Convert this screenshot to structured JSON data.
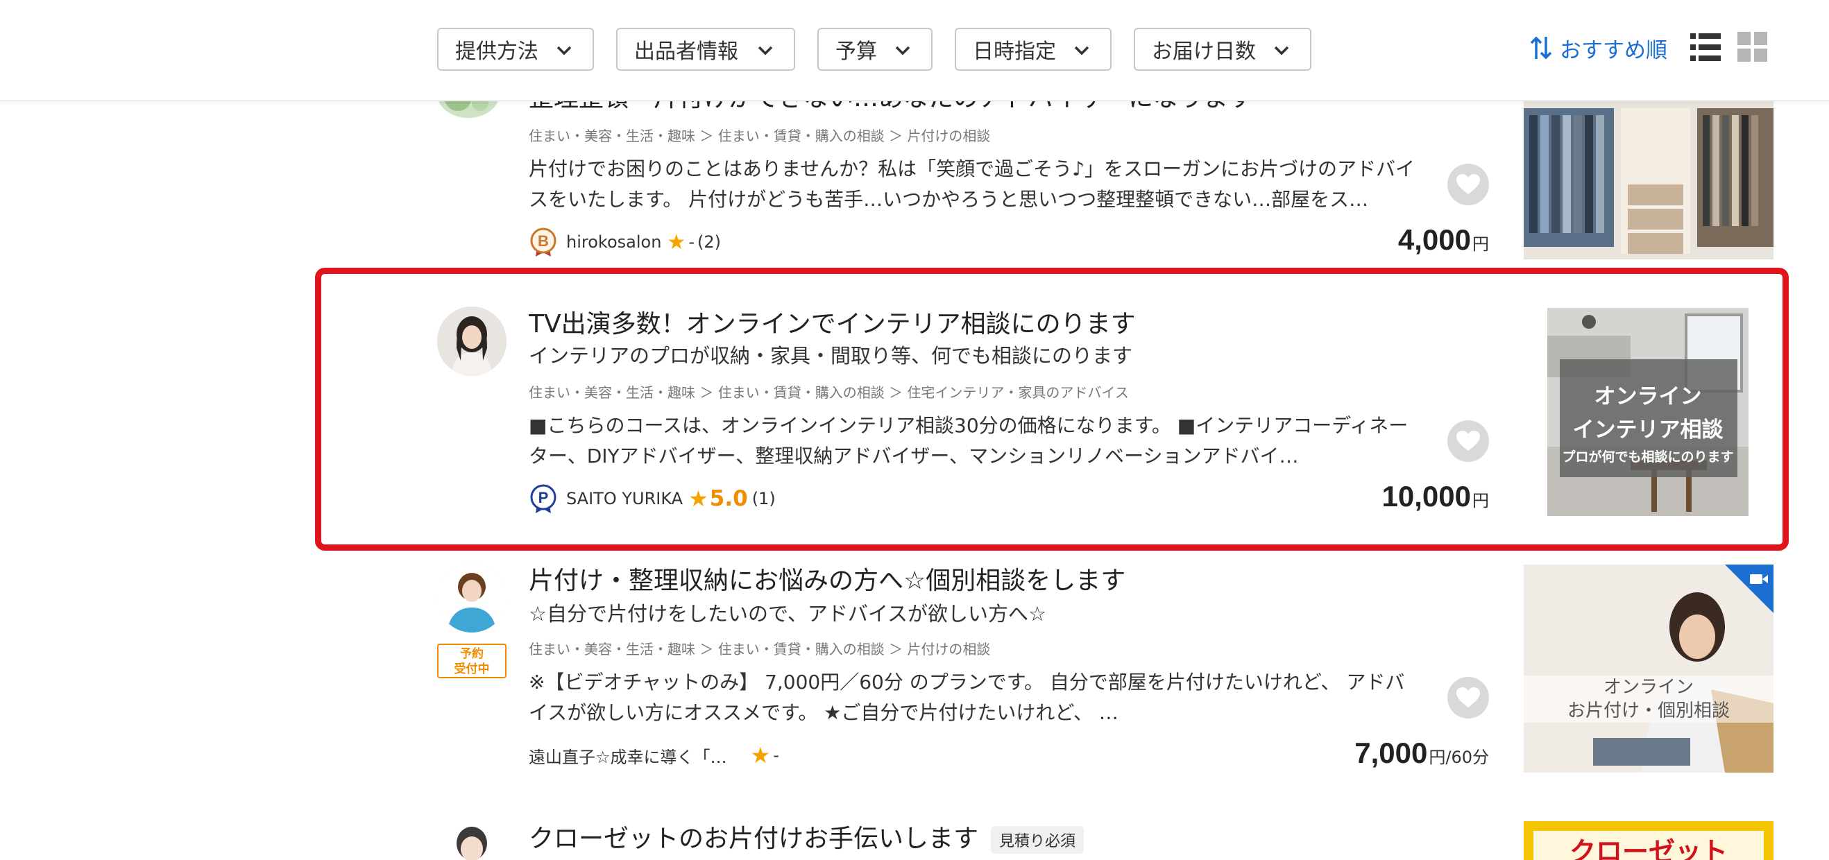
{
  "filters": [
    {
      "label": "提供方法"
    },
    {
      "label": "出品者情報"
    },
    {
      "label": "予算"
    },
    {
      "label": "日時指定"
    },
    {
      "label": "お届け日数"
    }
  ],
  "sort": {
    "label": "おすすめ順"
  },
  "view": {
    "list_icon": "list-view-icon",
    "grid_icon": "grid-view-icon"
  },
  "colors": {
    "accent": "#1a6fd1",
    "highlight": "#e0151b",
    "star": "#f5a300",
    "reserve": "#f08c00"
  },
  "items": [
    {
      "title": "整理整頓・片付けができない…あなたのアドバイザーになります",
      "crumbs": "住まい・美容・生活・趣味 ＞ 住まい・賃貸・購入の相談 ＞ 片付けの相談",
      "desc": "片付けでお困りのことはありませんか？私は「笑顔で過ごそう♪」をスローガンにお片づけのアドバイスをいたします。 片付けがどうも苦手…いつかやろうと思いつつ整理整頓できない…部屋をス…",
      "seller": "hirokosalon",
      "rank": "B",
      "rating": "-",
      "reviews": "(2)",
      "price": "4,000",
      "unit": "円"
    },
    {
      "title": "TV出演多数！オンラインでインテリア相談にのります",
      "subtitle": "インテリアのプロが収納・家具・間取り等、何でも相談にのります",
      "crumbs": "住まい・美容・生活・趣味 ＞ 住まい・賃貸・購入の相談 ＞ 住宅インテリア・家具のアドバイス",
      "desc": "■こちらのコースは、オンラインインテリア相談30分の価格になります。 ■インテリアコーディネーター、DIYアドバイザー、整理収納アドバイザー、マンションリノベーションアドバイ…",
      "seller": "SAITO YURIKA",
      "rank": "P",
      "rating": "5.0",
      "reviews": "(1)",
      "price": "10,000",
      "unit": "円",
      "thumb_line1": "オンライン",
      "thumb_line2": "インテリア相談",
      "thumb_line3": "プロが何でも相談にのります"
    },
    {
      "title": "片付け・整理収納にお悩みの方へ☆個別相談をします",
      "subtitle": "☆自分で片付けをしたいので、アドバイスが欲しい方へ☆",
      "crumbs": "住まい・美容・生活・趣味 ＞ 住まい・賃貸・購入の相談 ＞ 片付けの相談",
      "desc": "※【ビデオチャットのみ】 7,000円／60分 のプランです。 自分で部屋を片付けたいけれど、 アドバイスが欲しい方にオススメです。 ★ご自分で片付けたいけれど、 …",
      "seller": "遠山直子☆成幸に導く「…",
      "rating": "-",
      "price": "7,000",
      "unit": "円/60分",
      "reserve_line1": "予約",
      "reserve_line2": "受付中",
      "thumb_line1": "オンライン",
      "thumb_line2": "お片付け・個別相談"
    },
    {
      "title": "クローゼットのお片付けお手伝いします",
      "tag": "見積り必須",
      "thumb_text": "クローゼット"
    }
  ]
}
